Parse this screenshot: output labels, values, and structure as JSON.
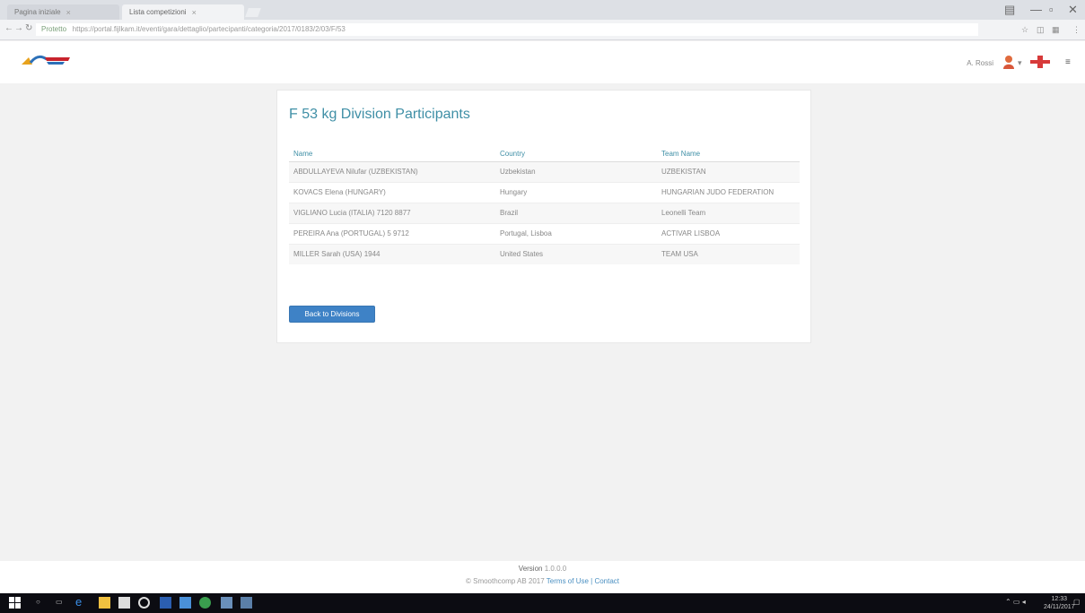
{
  "browser": {
    "tabs": [
      {
        "label": "Pagina iniziale"
      },
      {
        "label": "Lista competizioni"
      }
    ],
    "address": {
      "secure_label": "Protetto",
      "url": "https://portal.fijlkam.it/eventi/gara/dettaglio/partecipanti/categoria/2017/0183/2/03/F/53"
    }
  },
  "header": {
    "user_name": "A. Rossi"
  },
  "card": {
    "title": "F 53 kg Division Participants",
    "columns": [
      "Name",
      "Country",
      "Team Name"
    ],
    "rows": [
      [
        "ABDULLAYEVA Nilufar (UZBEKISTAN)",
        "Uzbekistan",
        "UZBEKISTAN"
      ],
      [
        "KOVACS Elena (HUNGARY)",
        "Hungary",
        "HUNGARIAN JUDO FEDERATION"
      ],
      [
        "VIGLIANO Lucia (ITALIA) 7120 8877",
        "Brazil",
        "Leonelli Team"
      ],
      [
        "PEREIRA Ana (PORTUGAL) 5 9712",
        "Portugal, Lisboa",
        "ACTIVAR LISBOA"
      ],
      [
        "MILLER Sarah (USA) 1944",
        "United States",
        "TEAM USA"
      ]
    ],
    "back_label": "Back to Divisions"
  },
  "footer": {
    "line1_main": "Version",
    "line1_sub": "1.0.0.0",
    "line2_prefix": "© Smoothcomp AB 2017",
    "line2_link": "Terms of Use | Contact"
  },
  "taskbar": {
    "time": "12:33",
    "date": "24/11/2017"
  },
  "colors": {
    "accent": "#3f8fa6",
    "button": "#3e82c6"
  }
}
